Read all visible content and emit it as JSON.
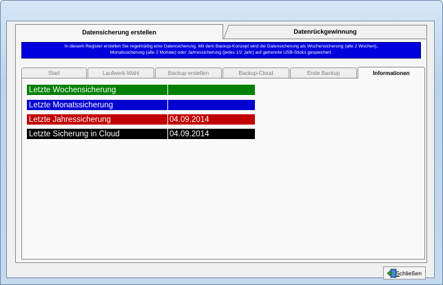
{
  "window": {
    "title": ""
  },
  "main_tabs": [
    {
      "label": "Datensicherung erstellen",
      "active": true
    },
    {
      "label": "Datenrückgewinnung",
      "active": false
    }
  ],
  "info": {
    "line1": "In diesem Register erstellen Sie regelmäßig eine Datensicherung. Mit dem Backup-Konzept wird die Datensicherung als Wochensicherung (alle 2 Wochen),",
    "line2": "Monatssicherung (alle 2 Monate) oder Jahressicherung (jedes 1/2 Jahr) auf getrennte USB-Sticks gespeichert."
  },
  "sub_tabs": [
    {
      "label": "Start",
      "active": false
    },
    {
      "label": "Laufwerk-Wahl",
      "active": false
    },
    {
      "label": "Backup erstellen",
      "active": false
    },
    {
      "label": "Backup-Cloud",
      "active": false
    },
    {
      "label": "Ende Backup",
      "active": false
    },
    {
      "label": "Informationen",
      "active": true
    }
  ],
  "backup_status": [
    {
      "label": "Letzte Wochensicherung",
      "value": "",
      "color": "#008000"
    },
    {
      "label": "Letzte Monatssicherung",
      "value": "",
      "color": "#0000d0"
    },
    {
      "label": "Letzte Jahressicherung",
      "value": "04.09.2014",
      "color": "#c00000"
    },
    {
      "label": "Letzte Sicherung in Cloud",
      "value": "04.09.2014",
      "color": "#000000"
    }
  ],
  "buttons": {
    "close_label": "Schließen"
  },
  "icons": {
    "close": "close-door-icon"
  }
}
